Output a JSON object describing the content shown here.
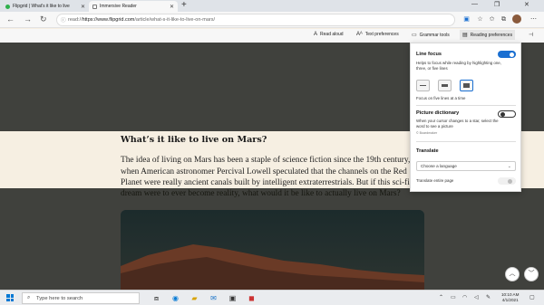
{
  "browser": {
    "tabs": [
      {
        "label": "Flipgrid | What's it like to live",
        "active": false
      },
      {
        "label": "Immersive Reader",
        "active": true
      }
    ],
    "new_tab_glyph": "+",
    "window_controls": [
      "—",
      "❐",
      "✕"
    ],
    "address": {
      "prefix": "read://",
      "host": "https://www.flipgrid.com",
      "path": "/article/what-s-it-like-to-live-on-mars/"
    }
  },
  "reader_toolbar": {
    "read_aloud": "Read aloud",
    "text_preferences": "Text preferences",
    "grammar_tools": "Grammar tools",
    "reading_preferences": "Reading preferences"
  },
  "article": {
    "heading": "What’s it like to live on Mars?",
    "lines": [
      "The idea of living on Mars has been a staple of science fiction since the 19th century,",
      "when American astronomer Percival Lowell speculated that the channels on the Red",
      "Planet were really ancient canals built by intelligent extraterrestrials. But if this sci-fi",
      "dream were to ever become reality, what would it be like to actually live on Mars?"
    ]
  },
  "panel": {
    "line_focus_title": "Line focus",
    "line_focus_desc": "Helps to focus while reading by highlighting one, three, or five lines",
    "line_focus_enabled": true,
    "line_focus_caption": "Focus on five lines at a time",
    "picture_dictionary_title": "Picture dictionary",
    "picture_dictionary_desc": "When your cursor changes to a star, select the word to see a picture",
    "picture_dictionary_credit": "© Boardmaker",
    "picture_dictionary_enabled": false,
    "translate_title": "Translate",
    "translate_select": "Choose a language",
    "translate_entire_page": "Translate entire page",
    "translate_entire_page_enabled": false
  },
  "taskbar": {
    "search_placeholder": "Type here to search",
    "time": "10:10 AM",
    "date": "4/1/2021"
  },
  "colors": {
    "accent": "#1a6fd1",
    "dim_overlay": "#40413d",
    "page_bg": "#f6efe2"
  }
}
